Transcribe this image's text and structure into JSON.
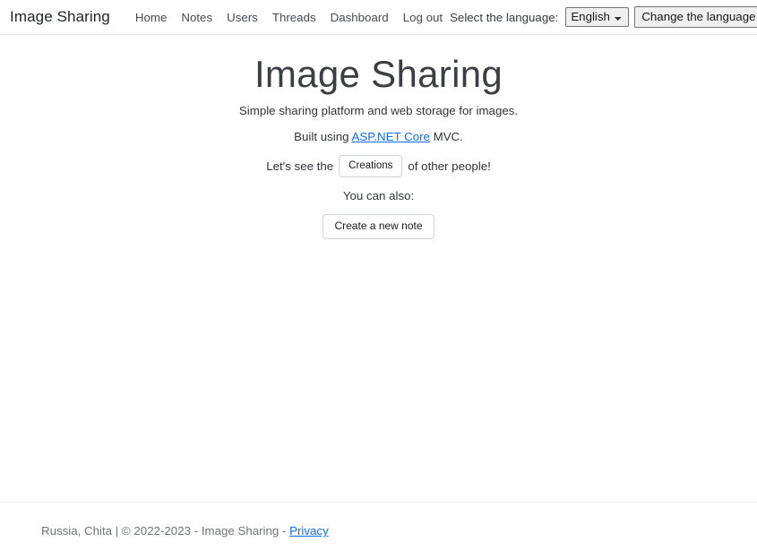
{
  "navbar": {
    "brand": "Image Sharing",
    "links": [
      {
        "label": "Home"
      },
      {
        "label": "Notes"
      },
      {
        "label": "Users"
      },
      {
        "label": "Threads"
      },
      {
        "label": "Dashboard"
      },
      {
        "label": "Log out"
      }
    ],
    "language": {
      "label": "Select the language:",
      "selected": "English",
      "options": [
        "English"
      ],
      "button": "Change the language"
    }
  },
  "main": {
    "title": "Image Sharing",
    "lead": "Simple sharing platform and web storage for images.",
    "built_prefix": "Built using ",
    "built_link": "ASP.NET Core",
    "built_suffix": " MVC.",
    "creations_prefix": "Let's see the",
    "creations_button": "Creations",
    "creations_suffix": "of other people!",
    "also": "You can also:",
    "note_button": "Create a new note"
  },
  "footer": {
    "text": "Russia, Chita | © 2022-2023 - Image Sharing - ",
    "link": "Privacy"
  },
  "colors": {
    "link": "#0d6efd",
    "muted": "#6c757d",
    "border": "#e9ecef",
    "title": "#3a3f44"
  }
}
